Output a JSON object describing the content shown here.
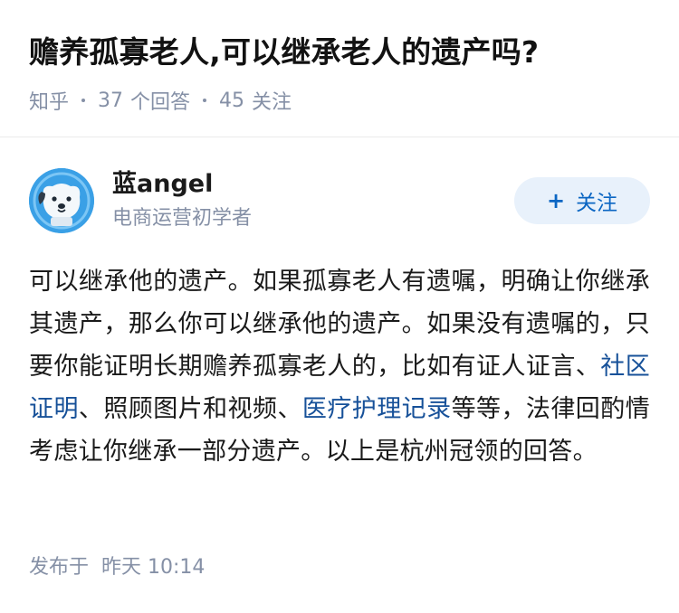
{
  "question": {
    "title": "赡养孤寡老人,可以继承老人的遗产吗?",
    "source": "知乎",
    "answer_count": "37",
    "answer_label": "个回答",
    "follow_count": "45",
    "follow_label": "关注"
  },
  "answer": {
    "author": {
      "name": "蓝angel",
      "bio": "电商运营初学者",
      "avatar_icon": "cartoon-dog-avatar"
    },
    "follow_button": {
      "icon": "plus-icon",
      "label": "关注"
    },
    "content": {
      "part1": "可以继承他的遗产。如果孤寡老人有遗嘱，明确让你继承其遗产，那么你可以继承他的遗产。如果没有遗嘱的，只要你能证明长期赡养孤寡老人的，比如有证人证言、",
      "link1": "社区证明",
      "part2": "、照顾图片和视频、",
      "link2": "医疗护理记录",
      "part3": "等等，法律回酌情考虑让你继承一部分遗产。以上是杭州冠领的回答。"
    },
    "post_time": {
      "label": "发布于",
      "value": "昨天 10:14"
    }
  },
  "colors": {
    "link": "#175199",
    "meta": "#8590a6",
    "button_bg": "#e8f1fb",
    "button_text": "#0b66c3",
    "avatar_bg": "#3aa0e6"
  }
}
